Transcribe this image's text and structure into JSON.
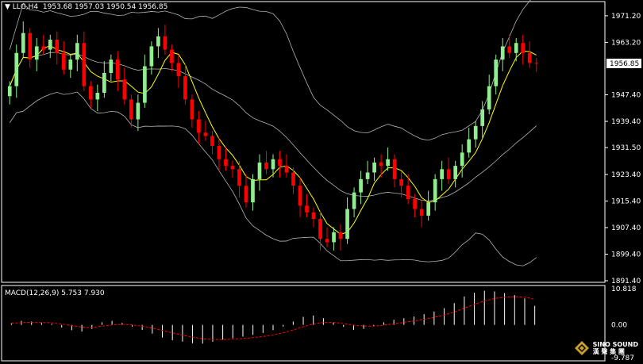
{
  "header": {
    "symbol": "LLG,H4",
    "ohlc": "1953.68 1957.03 1950.54 1956.85"
  },
  "macd_header": {
    "label": "MACD(12,26,9)",
    "values": "5.753 7.930"
  },
  "price_axis": {
    "ticks": [
      "1971.20",
      "1963.20",
      "1947.40",
      "1939.40",
      "1931.50",
      "1923.40",
      "1915.40",
      "1907.40",
      "1899.40",
      "1891.40"
    ],
    "current_price": "1956.85"
  },
  "macd_axis": {
    "ticks": [
      "10.818",
      "0.00",
      "-9.787"
    ]
  },
  "logo": {
    "line1": "SINO SOUND",
    "line2": "漢 聲 集 團"
  },
  "colors": {
    "bull": "#90ee90",
    "bear": "#ff0000",
    "ma": "#ffff00",
    "bands": "#b4b4b4",
    "macd_hist": "#ffffff",
    "macd_signal": "#ff0000",
    "price_tag_bg": "#ffffff"
  },
  "chart_data": [
    {
      "type": "candlestick",
      "title": "LLG,H4",
      "ylim": [
        1891.4,
        1975
      ],
      "indicators": [
        "Bollinger Bands",
        "Moving Average"
      ],
      "close": [
        1950,
        1960,
        1966,
        1958,
        1962,
        1961,
        1964,
        1960,
        1955,
        1958,
        1963,
        1950,
        1946,
        1948,
        1954,
        1958,
        1952,
        1946,
        1940,
        1945,
        1956,
        1962,
        1965,
        1961,
        1957,
        1953,
        1946,
        1940,
        1936,
        1935,
        1932,
        1928,
        1926,
        1925,
        1920,
        1915,
        1922,
        1927,
        1925,
        1928,
        1926,
        1924,
        1920,
        1914,
        1912,
        1910,
        1904,
        1903,
        1906,
        1904,
        1913,
        1918,
        1922,
        1924,
        1927,
        1926,
        1928,
        1922,
        1920,
        1916,
        1913,
        1911,
        1915,
        1922,
        1925,
        1922,
        1926,
        1930,
        1934,
        1938,
        1943,
        1950,
        1958,
        1962,
        1960,
        1963,
        1960,
        1957,
        1956.85
      ]
    },
    {
      "type": "bar",
      "title": "MACD(12,26,9)",
      "ylim": [
        -9.787,
        10.818
      ],
      "signal_line": true,
      "values": [
        0.5,
        1.2,
        1.0,
        0.6,
        0.3,
        -0.8,
        -1.6,
        -2.0,
        -1.2,
        0.8,
        1.2,
        0.6,
        -0.5,
        -1.5,
        -2.6,
        -3.8,
        -4.6,
        -5.0,
        -5.5,
        -5.6,
        -5.0,
        -4.4,
        -4.0,
        -3.5,
        -3.0,
        -2.4,
        -1.6,
        -0.5,
        1.0,
        2.4,
        2.8,
        2.0,
        0.8,
        -0.6,
        -1.5,
        -1.2,
        -0.4,
        0.8,
        1.5,
        2.0,
        2.5,
        3.2,
        4.0,
        5.0,
        6.5,
        8.5,
        9.6,
        10.2,
        10.0,
        9.5,
        8.9,
        7.9,
        5.7
      ]
    }
  ]
}
